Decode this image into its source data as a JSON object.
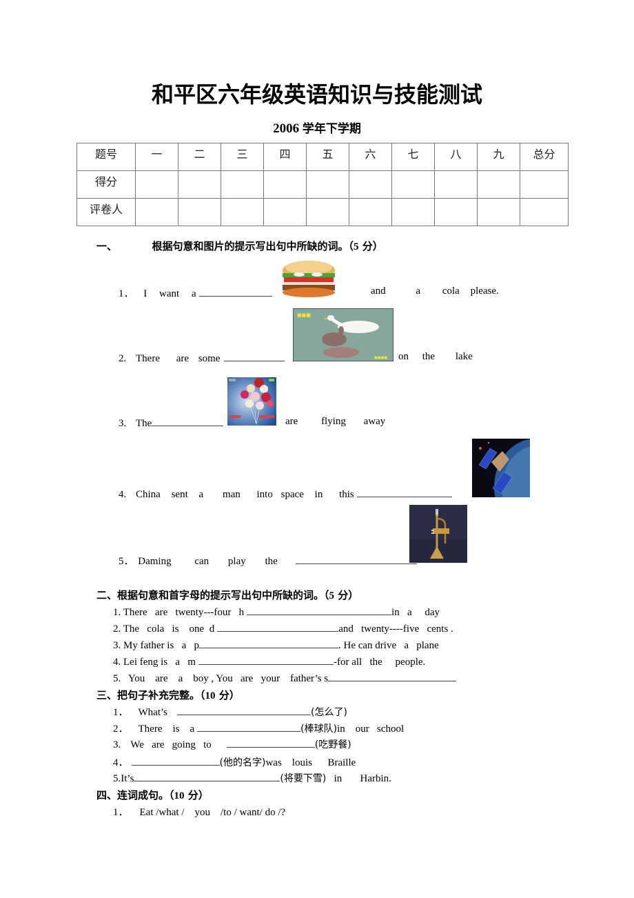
{
  "header": {
    "title": "和平区六年级英语知识与技能测试",
    "subtitle_year": "2006",
    "subtitle_term": "学年下学期"
  },
  "score_table": {
    "header_row": [
      "题号",
      "一",
      "二",
      "三",
      "四",
      "五",
      "六",
      "七",
      "八",
      "九",
      "总分"
    ],
    "row_labels": [
      "得分",
      "评卷人"
    ]
  },
  "section1": {
    "index": "一、",
    "instruction": "根据句意和图片的提示写出句中所缺的词。（",
    "points": "5",
    "points_suffix": " 分）",
    "items": [
      {
        "num": "1．",
        "words": [
          "I",
          "want",
          "a"
        ],
        "after": [
          "and",
          "a",
          "cola",
          "please."
        ],
        "image": "hamburger-image"
      },
      {
        "num": "2.",
        "words": [
          "There",
          "are",
          "some"
        ],
        "after": [
          "on",
          "the",
          "lake"
        ],
        "image": "ducks-image"
      },
      {
        "num": "3.",
        "words": [
          "The"
        ],
        "after": [
          "are",
          "flying",
          "away"
        ],
        "image": "balloons-image"
      },
      {
        "num": "4.",
        "words": [
          "China",
          "sent",
          "a",
          "man",
          "into",
          "space",
          "in",
          "this"
        ],
        "after": [],
        "image": "spaceship-image"
      },
      {
        "num": "5．",
        "words": [
          "Daming",
          "can",
          "play",
          "the"
        ],
        "after": [],
        "image": "trumpet-image"
      }
    ]
  },
  "section2": {
    "index": "二、",
    "instruction": "根据句意和首字母的提示写出句中所缺的词。（",
    "points": "5",
    "points_suffix": " 分）",
    "items": [
      {
        "before": "1. There   are   twenty---four   h",
        "after": "in   a     day"
      },
      {
        "before": "2. The   cola   is    one  d",
        "after": "and   twenty----five   cents ."
      },
      {
        "before": "3. My father is   a   p",
        "after": ". He can drive   a   plane"
      },
      {
        "before": "4. Lei feng is   a   m",
        "after": "-for all   the     people."
      },
      {
        "before": "5.   You    are    a    boy , You   are   your    father’s s",
        "after": ""
      }
    ]
  },
  "section3": {
    "index": "三、",
    "instruction": "把句子补充完整。（",
    "points": "10",
    "points_suffix": " 分）",
    "items": [
      {
        "num": "1．",
        "before": "What’s",
        "hint": "(怎么了)",
        "after": ""
      },
      {
        "num": "2．",
        "before": "There    is    a",
        "hint": "(棒球队)",
        "after": "in    our   school"
      },
      {
        "num": "3.",
        "before": "We   are   going   to",
        "hint": "(吃野餐)",
        "after": ""
      },
      {
        "num": "4．",
        "before": "",
        "hint": "(他的名字)",
        "after": "was    louis      Braille"
      },
      {
        "num": "5.It’s",
        "before": "",
        "hint": "(将要下雪)",
        "after": "   in       Harbin."
      }
    ]
  },
  "section4": {
    "index": "四、",
    "instruction": "连词成句。（",
    "points": "10",
    "points_suffix": " 分）",
    "items": [
      {
        "num": "1．",
        "text": "Eat /what /    you    /to / want/ do /?"
      }
    ]
  }
}
